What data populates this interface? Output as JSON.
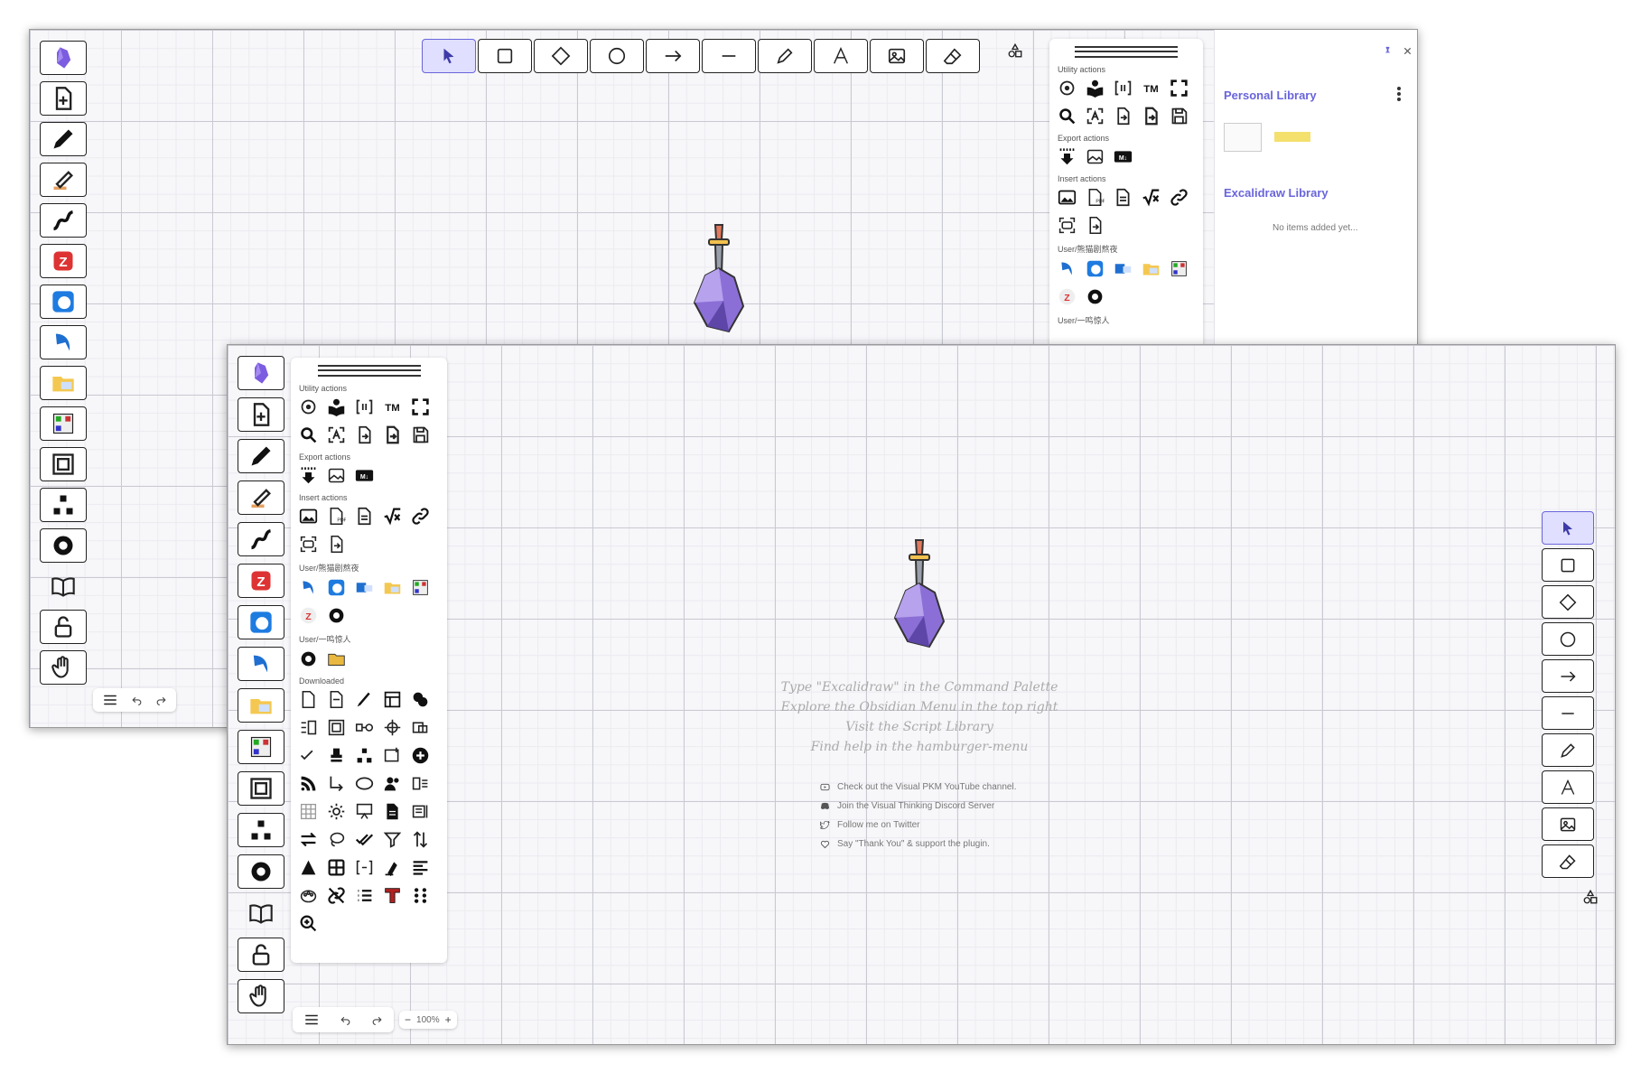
{
  "back_window": {
    "top_toolbar": [
      "selection",
      "rectangle",
      "diamond",
      "ellipse",
      "arrow",
      "line",
      "draw",
      "text",
      "image",
      "eraser"
    ],
    "active_tool": "selection",
    "left_toolbar": [
      "obsidian-logo",
      "new-file",
      "pen",
      "highlighter",
      "ink",
      "zotero",
      "edge",
      "arrow-cursor",
      "folder-image",
      "qr-code",
      "frame",
      "hierarchy",
      "settings",
      "book",
      "lock",
      "hand"
    ],
    "library": {
      "personal_title": "Personal Library",
      "excalidraw_title": "Excalidraw Library",
      "empty_text": "No items added yet..."
    },
    "panel": {
      "utility_label": "Utility actions",
      "export_label": "Export actions",
      "insert_label": "Insert actions",
      "user1_label": "User/熊猫剧熬夜",
      "user2_label": "User/一鸣惊人"
    }
  },
  "front_window": {
    "panel": {
      "utility_label": "Utility actions",
      "export_label": "Export actions",
      "insert_label": "Insert actions",
      "user1_label": "User/熊猫剧熬夜",
      "user2_label": "User/一鸣惊人",
      "downloaded_label": "Downloaded"
    },
    "welcome_lines": [
      "Type \"Excalidraw\" in the Command Palette",
      "Explore the Obsidian Menu in the top right",
      "Visit the Script Library",
      "Find help in the hamburger-menu"
    ],
    "links": [
      {
        "icon": "youtube-icon",
        "text": "Check out the Visual PKM YouTube channel."
      },
      {
        "icon": "discord-icon",
        "text": "Join the Visual Thinking Discord Server"
      },
      {
        "icon": "twitter-icon",
        "text": "Follow me on Twitter"
      },
      {
        "icon": "heart-icon",
        "text": "Say \"Thank You\" & support the plugin."
      }
    ],
    "zoom": "100%",
    "right_toolbar": [
      "selection",
      "rectangle",
      "diamond",
      "ellipse",
      "arrow",
      "line",
      "draw",
      "text",
      "image",
      "eraser"
    ]
  },
  "colors": {
    "accent": "#6965db",
    "active_bg": "#e0dfff",
    "gem": "#8b6fd6"
  }
}
